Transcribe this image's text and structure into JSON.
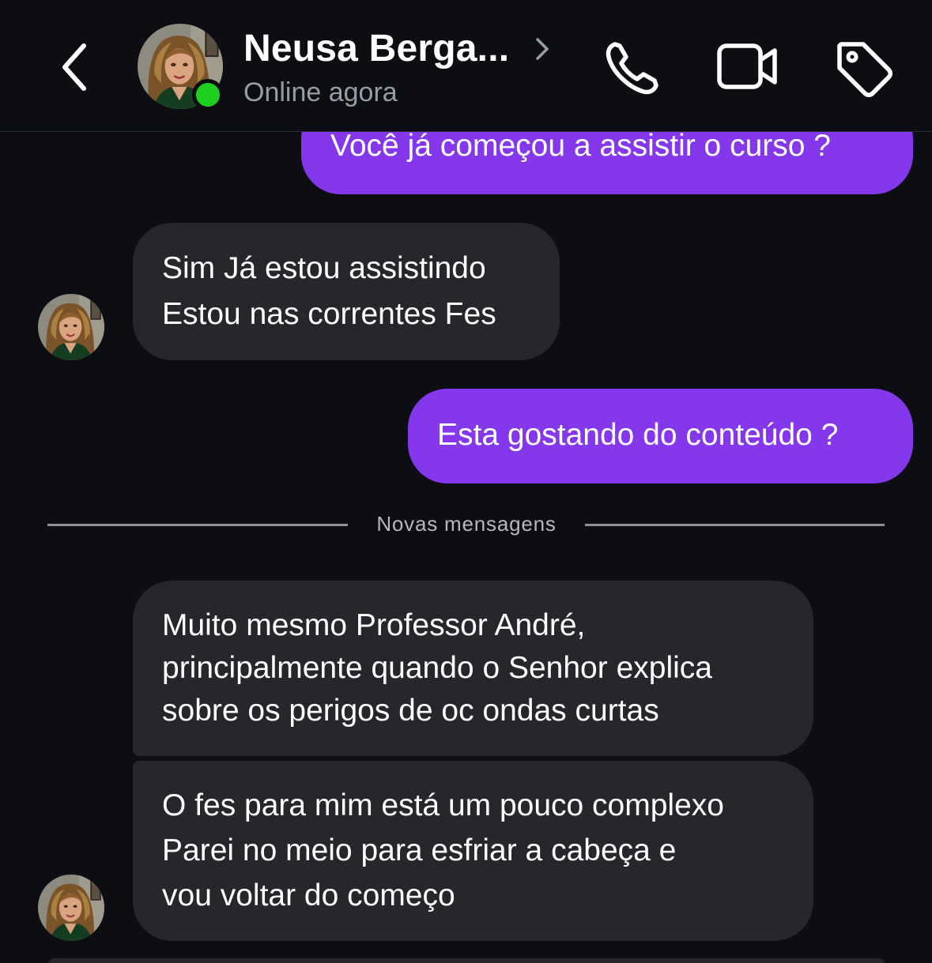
{
  "header": {
    "back_icon": "chevron-left-icon",
    "contact_name": "Neusa Berga...",
    "status": "Online agora",
    "status_color": "#1ed01e",
    "actions": [
      "phone-icon",
      "video-camera-icon",
      "tag-icon"
    ]
  },
  "messages": [
    {
      "direction": "outgoing",
      "lines": [
        "Você já começou a assistir o curso ?"
      ]
    },
    {
      "direction": "incoming",
      "lines": [
        "Sim Já estou assistindo",
        "Estou nas correntes Fes"
      ]
    },
    {
      "direction": "outgoing",
      "lines": [
        "Esta gostando do conteúdo ?"
      ]
    },
    {
      "direction": "incoming",
      "lines": [
        "Muito mesmo Professor André,",
        "principalmente quando o Senhor explica",
        "sobre os perigos de oc ondas curtas"
      ]
    },
    {
      "direction": "incoming",
      "lines": [
        "O fes para mim está um pouco complexo",
        "Parei no meio para esfriar a cabeça e",
        "vou voltar do começo"
      ]
    }
  ],
  "divider": {
    "label": "Novas mensagens"
  },
  "colors": {
    "background": "#0c0e13",
    "outgoing_bubble": "#8437eb",
    "incoming_bubble": "#25272d",
    "muted_text": "#9a9ca3"
  }
}
